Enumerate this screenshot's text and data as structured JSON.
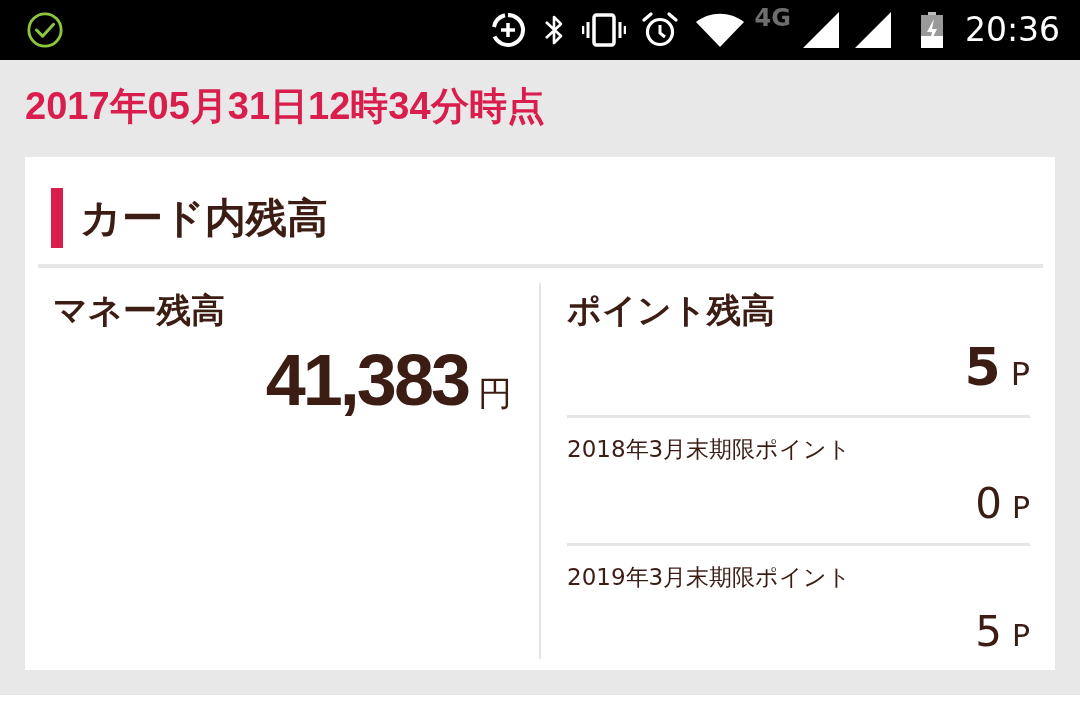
{
  "status_bar": {
    "network": "4G",
    "time": "20:36"
  },
  "timestamp": "2017年05月31日12時34分時点",
  "card": {
    "title": "カード内残高",
    "money": {
      "label": "マネー残高",
      "amount": "41,383",
      "unit": "円"
    },
    "points": {
      "label": "ポイント残高",
      "amount": "5",
      "unit": "P",
      "expiring": [
        {
          "label": "2018年3月末期限ポイント",
          "amount": "0",
          "unit": "P"
        },
        {
          "label": "2019年3月末期限ポイント",
          "amount": "5",
          "unit": "P"
        }
      ]
    }
  }
}
